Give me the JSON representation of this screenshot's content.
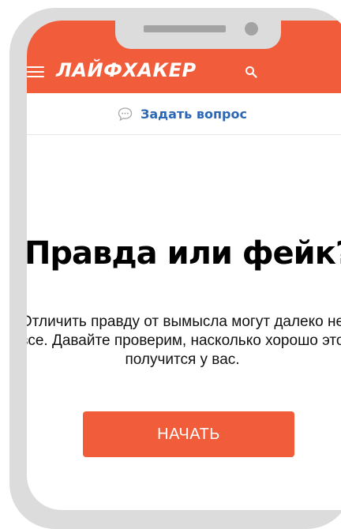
{
  "header": {
    "logo_text": "ЛАЙФХАКЕР",
    "menu_icon": "hamburger-menu-icon",
    "search_icon": "search-icon",
    "background_color": "#f15d3b"
  },
  "ask_bar": {
    "icon": "chat-bubble-icon",
    "label": "Задать вопрос",
    "link_color": "#2b67b4"
  },
  "main": {
    "title": "Правда или фейк?",
    "description": "Отличить правду от вымысла могут далеко не все. Давайте проверим, насколько хорошо это получится у вас.",
    "start_button_label": "НАЧАТЬ",
    "button_color": "#f15d3b"
  }
}
